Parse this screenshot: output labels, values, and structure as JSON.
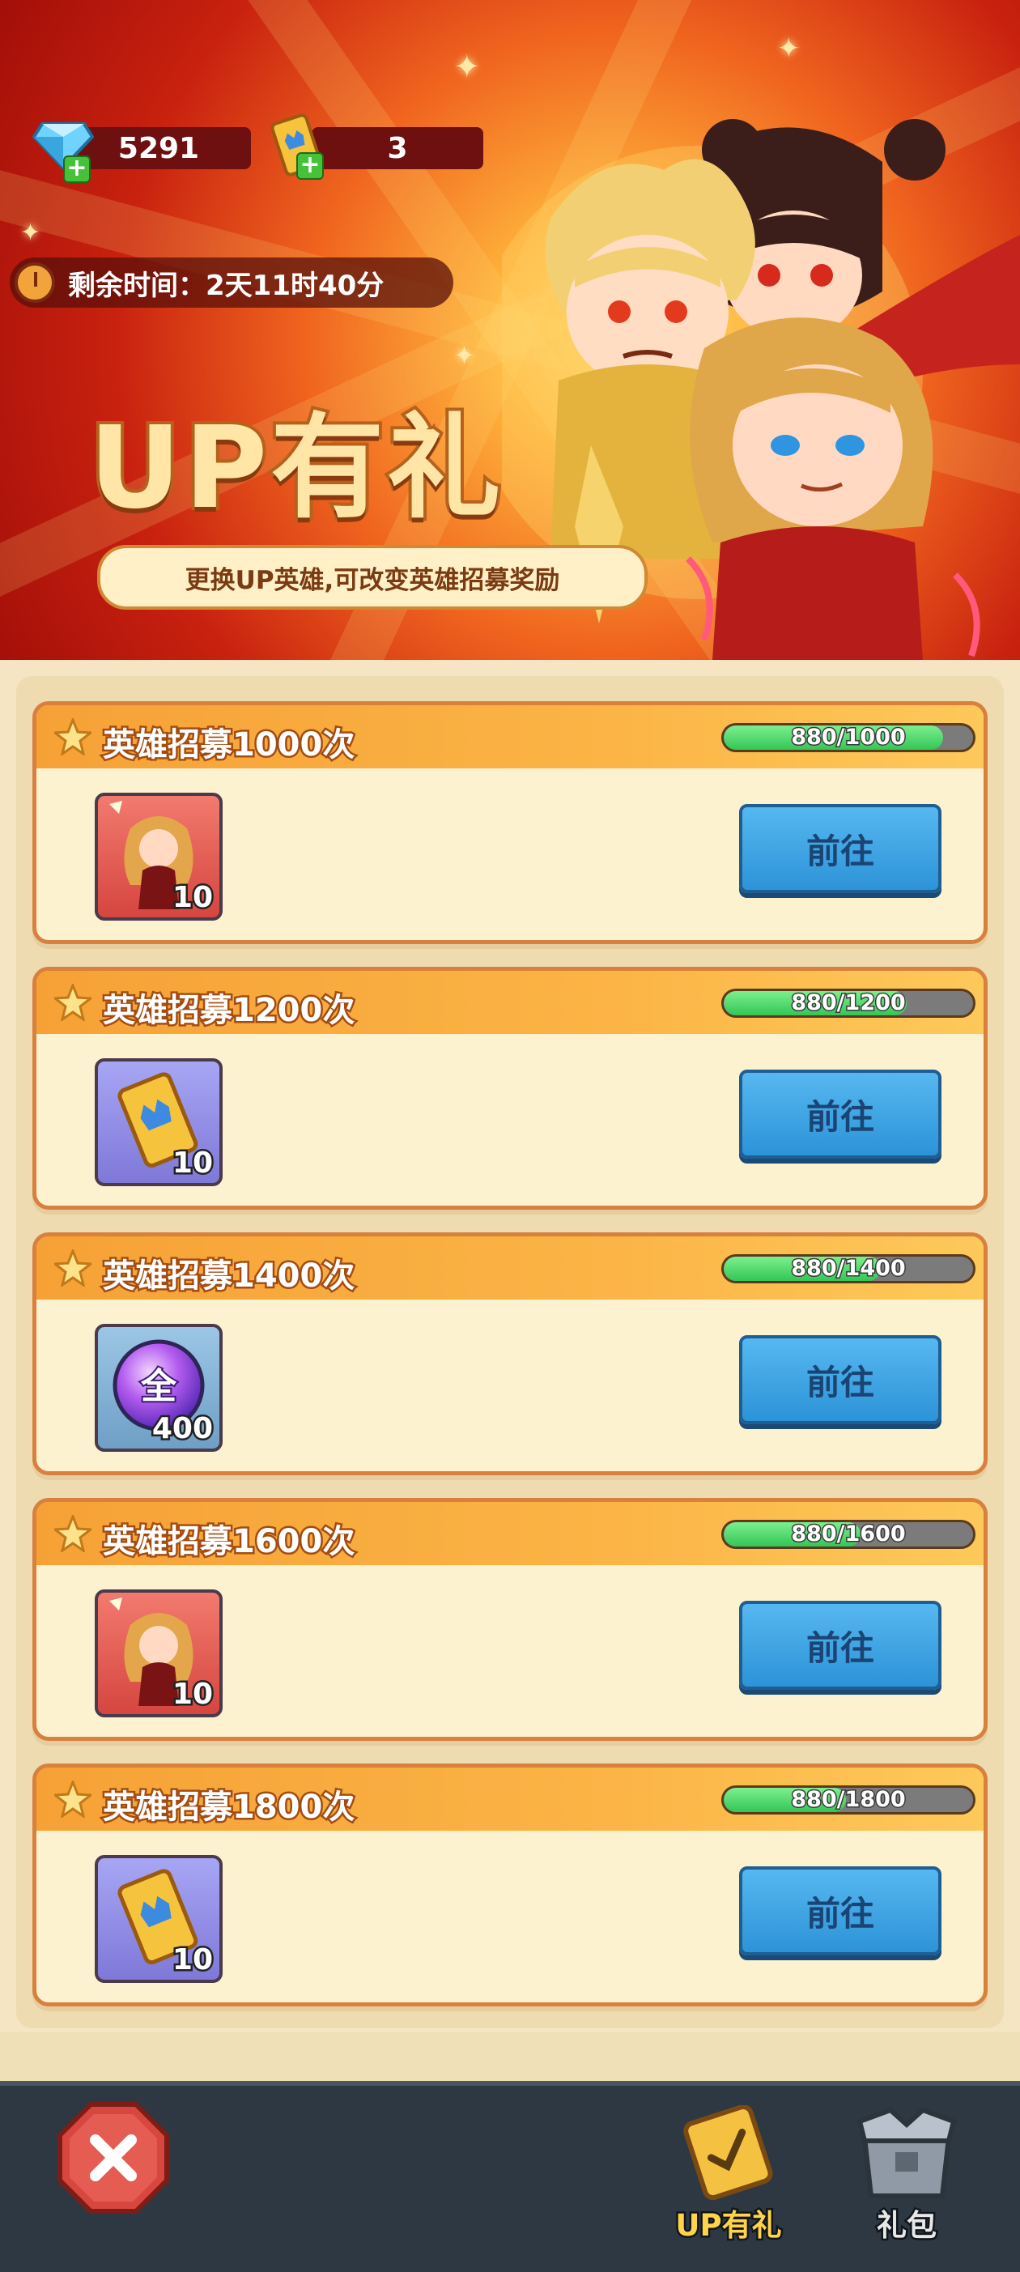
{
  "currency": {
    "gems": "5291",
    "tickets": "3"
  },
  "timer": {
    "label": "剩余时间：2天11时40分"
  },
  "banner": {
    "title": "UP有礼",
    "subtitle": "更换UP英雄,可改变英雄招募奖励"
  },
  "colors": {
    "accent": "#f6a136",
    "button": "#2d93d8",
    "progress": "#33c656",
    "nav_bg": "#2e3842"
  },
  "tasks": [
    {
      "title": "英雄招募1000次",
      "progress_text": "880/1000",
      "progress": 0.88,
      "reward_type": "hero-card-icon",
      "reward_count": "10",
      "button": "前往"
    },
    {
      "title": "英雄招募1200次",
      "progress_text": "880/1200",
      "progress": 0.733,
      "reward_type": "recruit-ticket-icon",
      "reward_count": "10",
      "button": "前往"
    },
    {
      "title": "英雄招募1400次",
      "progress_text": "880/1400",
      "progress": 0.629,
      "reward_type": "all-orb-icon",
      "reward_glyph": "全",
      "reward_count": "400",
      "button": "前往"
    },
    {
      "title": "英雄招募1600次",
      "progress_text": "880/1600",
      "progress": 0.55,
      "reward_type": "hero-card-icon",
      "reward_count": "10",
      "button": "前往"
    },
    {
      "title": "英雄招募1800次",
      "progress_text": "880/1800",
      "progress": 0.489,
      "reward_type": "recruit-ticket-icon",
      "reward_count": "10",
      "button": "前往"
    }
  ],
  "nav": {
    "tab_up": "UP有礼",
    "tab_gift": "礼包"
  }
}
